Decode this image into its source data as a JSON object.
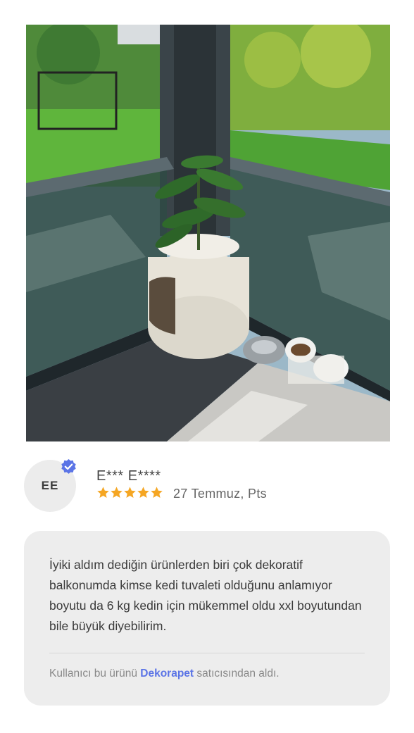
{
  "review_photo": {
    "alt": "photo",
    "scene_icon": "cat-litter-planter-photo"
  },
  "reviewer": {
    "initials": "EE",
    "name": "E*** E****",
    "verified_icon": "verified-check-icon",
    "rating": 5,
    "rating_max": 5,
    "date": "27 Temmuz, Pts"
  },
  "review": {
    "text": "İyiki aldım dediğin ürünlerden biri çok dekoratif balkonumda kimse kedi tuvaleti olduğunu anlamıyor boyutu da 6 kg kedin için mükemmel oldu xxl boyutundan bile büyük diyebilirim.",
    "seller_prefix": "Kullanıcı bu ürünü",
    "seller_name": "Dekorapet",
    "seller_suffix": "satıcısından aldı."
  },
  "colors": {
    "star": "#f5a623",
    "verified": "#5b74e6",
    "seller_link": "#5b74e6",
    "card_bg": "#ededed"
  }
}
